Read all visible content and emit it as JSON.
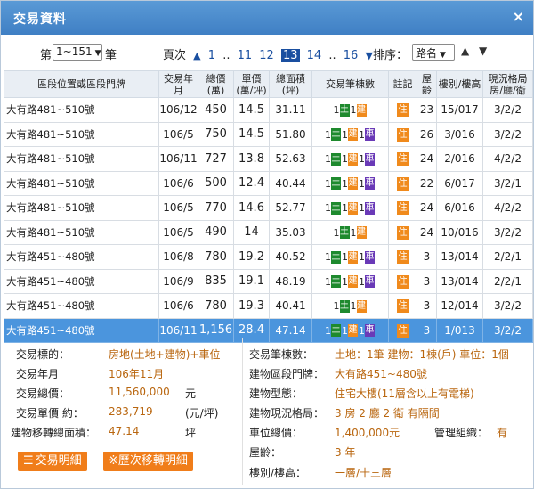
{
  "title": "交易資料",
  "close_label": "×",
  "toolbar": {
    "nth_prefix": "第",
    "range_select": "1~151",
    "nth_suffix": "筆",
    "page_label": "頁次",
    "pages": [
      "1",
      "..",
      "11",
      "12",
      "13",
      "14",
      "..",
      "16"
    ],
    "current_page": "13",
    "sort_label": "排序：",
    "sort_select": "路名"
  },
  "table": {
    "headers": [
      "區段位置或區段門牌",
      "交易年月",
      "總價(萬)",
      "單價(萬/坪)",
      "總面積(坪)",
      "交易筆棟數",
      "註記",
      "屋齡",
      "樓別/樓高",
      "現況格局房/廳/衛"
    ],
    "rows": [
      {
        "addr": "大有路481~510號",
        "date": "106/12",
        "total": "450",
        "unit": "14.5",
        "area": "31.11",
        "land": "1",
        "bldg": "1",
        "park": "",
        "note": "住",
        "age": "23",
        "floor": "15/017",
        "layout": "3/2/2"
      },
      {
        "addr": "大有路481~510號",
        "date": "106/5",
        "total": "750",
        "unit": "14.5",
        "area": "51.80",
        "land": "1",
        "bldg": "1",
        "park": "1",
        "note": "住",
        "age": "26",
        "floor": "3/016",
        "layout": "3/2/2"
      },
      {
        "addr": "大有路481~510號",
        "date": "106/11",
        "total": "727",
        "unit": "13.8",
        "area": "52.63",
        "land": "1",
        "bldg": "1",
        "park": "1",
        "note": "住",
        "age": "24",
        "floor": "2/016",
        "layout": "4/2/2"
      },
      {
        "addr": "大有路481~510號",
        "date": "106/6",
        "total": "500",
        "unit": "12.4",
        "area": "40.44",
        "land": "1",
        "bldg": "1",
        "park": "1",
        "note": "住",
        "age": "22",
        "floor": "6/017",
        "layout": "3/2/1"
      },
      {
        "addr": "大有路481~510號",
        "date": "106/5",
        "total": "770",
        "unit": "14.6",
        "area": "52.77",
        "land": "1",
        "bldg": "1",
        "park": "1",
        "note": "住",
        "age": "24",
        "floor": "6/016",
        "layout": "4/2/2"
      },
      {
        "addr": "大有路481~510號",
        "date": "106/5",
        "total": "490",
        "unit": "14",
        "area": "35.03",
        "land": "1",
        "bldg": "1",
        "park": "",
        "note": "住",
        "age": "24",
        "floor": "10/016",
        "layout": "3/2/2"
      },
      {
        "addr": "大有路451~480號",
        "date": "106/8",
        "total": "780",
        "unit": "19.2",
        "area": "40.52",
        "land": "1",
        "bldg": "1",
        "park": "1",
        "note": "住",
        "age": "3",
        "floor": "13/014",
        "layout": "2/2/1"
      },
      {
        "addr": "大有路451~480號",
        "date": "106/9",
        "total": "835",
        "unit": "19.1",
        "area": "48.19",
        "land": "1",
        "bldg": "1",
        "park": "1",
        "note": "住",
        "age": "3",
        "floor": "13/014",
        "layout": "2/2/1"
      },
      {
        "addr": "大有路451~480號",
        "date": "106/6",
        "total": "780",
        "unit": "19.3",
        "area": "40.41",
        "land": "1",
        "bldg": "1",
        "park": "",
        "note": "住",
        "age": "3",
        "floor": "12/014",
        "layout": "3/2/2"
      },
      {
        "addr": "大有路451~480號",
        "date": "106/11",
        "total": "1,156",
        "unit": "28.4",
        "area": "47.14",
        "land": "1",
        "bldg": "1",
        "park": "1",
        "note": "住",
        "age": "3",
        "floor": "1/013",
        "layout": "3/2/2"
      }
    ],
    "badge_land": "土",
    "badge_bldg": "建",
    "badge_park": "車"
  },
  "detail": {
    "target_k": "交易標的：",
    "target_v": "房地(土地+建物)+車位",
    "ym_k": "交易年月",
    "ym_v": "106年11月",
    "total_k": "交易總價：",
    "total_v": "11,560,000",
    "total_u": "元",
    "unit_k": "交易單價 約：",
    "unit_v": "283,719",
    "unit_u": "(元/坪)",
    "area_k": "建物移轉總面積：",
    "area_v": "47.14",
    "area_u": "坪",
    "count_k": "交易筆棟數：",
    "count_v": "土地：1筆 建物：1棟(戶) 車位：1個",
    "addr_k": "建物區段門牌：",
    "addr_v": "大有路451~480號",
    "type_k": "建物型態：",
    "type_v": "住宅大樓(11層含以上有電梯)",
    "layout_k": "建物現況格局：",
    "layout_v": "3 房 2 廳 2 衛 有隔間",
    "park_k": "車位總價：",
    "park_v": "1,400,000元",
    "mgmt_k": "管理組織：",
    "mgmt_v": "有",
    "age_k": "屋齡：",
    "age_v": "3 年",
    "floor_k": "樓別/樓高：",
    "floor_v": "一層/十三層",
    "btn_detail": "交易明細",
    "btn_history": "※歷次移轉明細"
  }
}
